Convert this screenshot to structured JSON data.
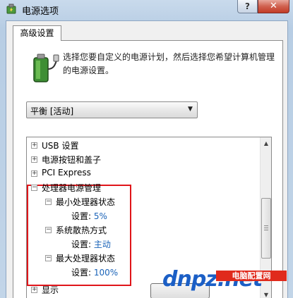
{
  "window": {
    "title": "电源选项",
    "help_label": "?",
    "close_label": "✕"
  },
  "tab": {
    "label": "高级设置"
  },
  "description": "选择您要自定义的电源计划，然后选择您希望计算机管理的电源设置。",
  "plan_select": {
    "value": "平衡 [活动]"
  },
  "tree": {
    "items": [
      {
        "label": "USB 设置",
        "expanded": false
      },
      {
        "label": "电源按钮和盖子",
        "expanded": false
      },
      {
        "label": "PCI Express",
        "expanded": false
      },
      {
        "label": "处理器电源管理",
        "expanded": true
      },
      {
        "label": "最小处理器状态",
        "expanded": true
      },
      {
        "label": "系统散热方式",
        "expanded": true
      },
      {
        "label": "最大处理器状态",
        "expanded": true
      },
      {
        "label": "显示",
        "expanded": false
      }
    ],
    "settings": [
      {
        "prefix": "设置: ",
        "value": "5%"
      },
      {
        "prefix": "设置: ",
        "value": "主动"
      },
      {
        "prefix": "设置: ",
        "value": "100%"
      }
    ]
  },
  "watermark": {
    "main": "dnpz.net",
    "site": "电脑配置网"
  },
  "colors": {
    "highlight_box": "#e0151a",
    "setting_value": "#1a63b8",
    "watermark": "#1b5fc6"
  }
}
